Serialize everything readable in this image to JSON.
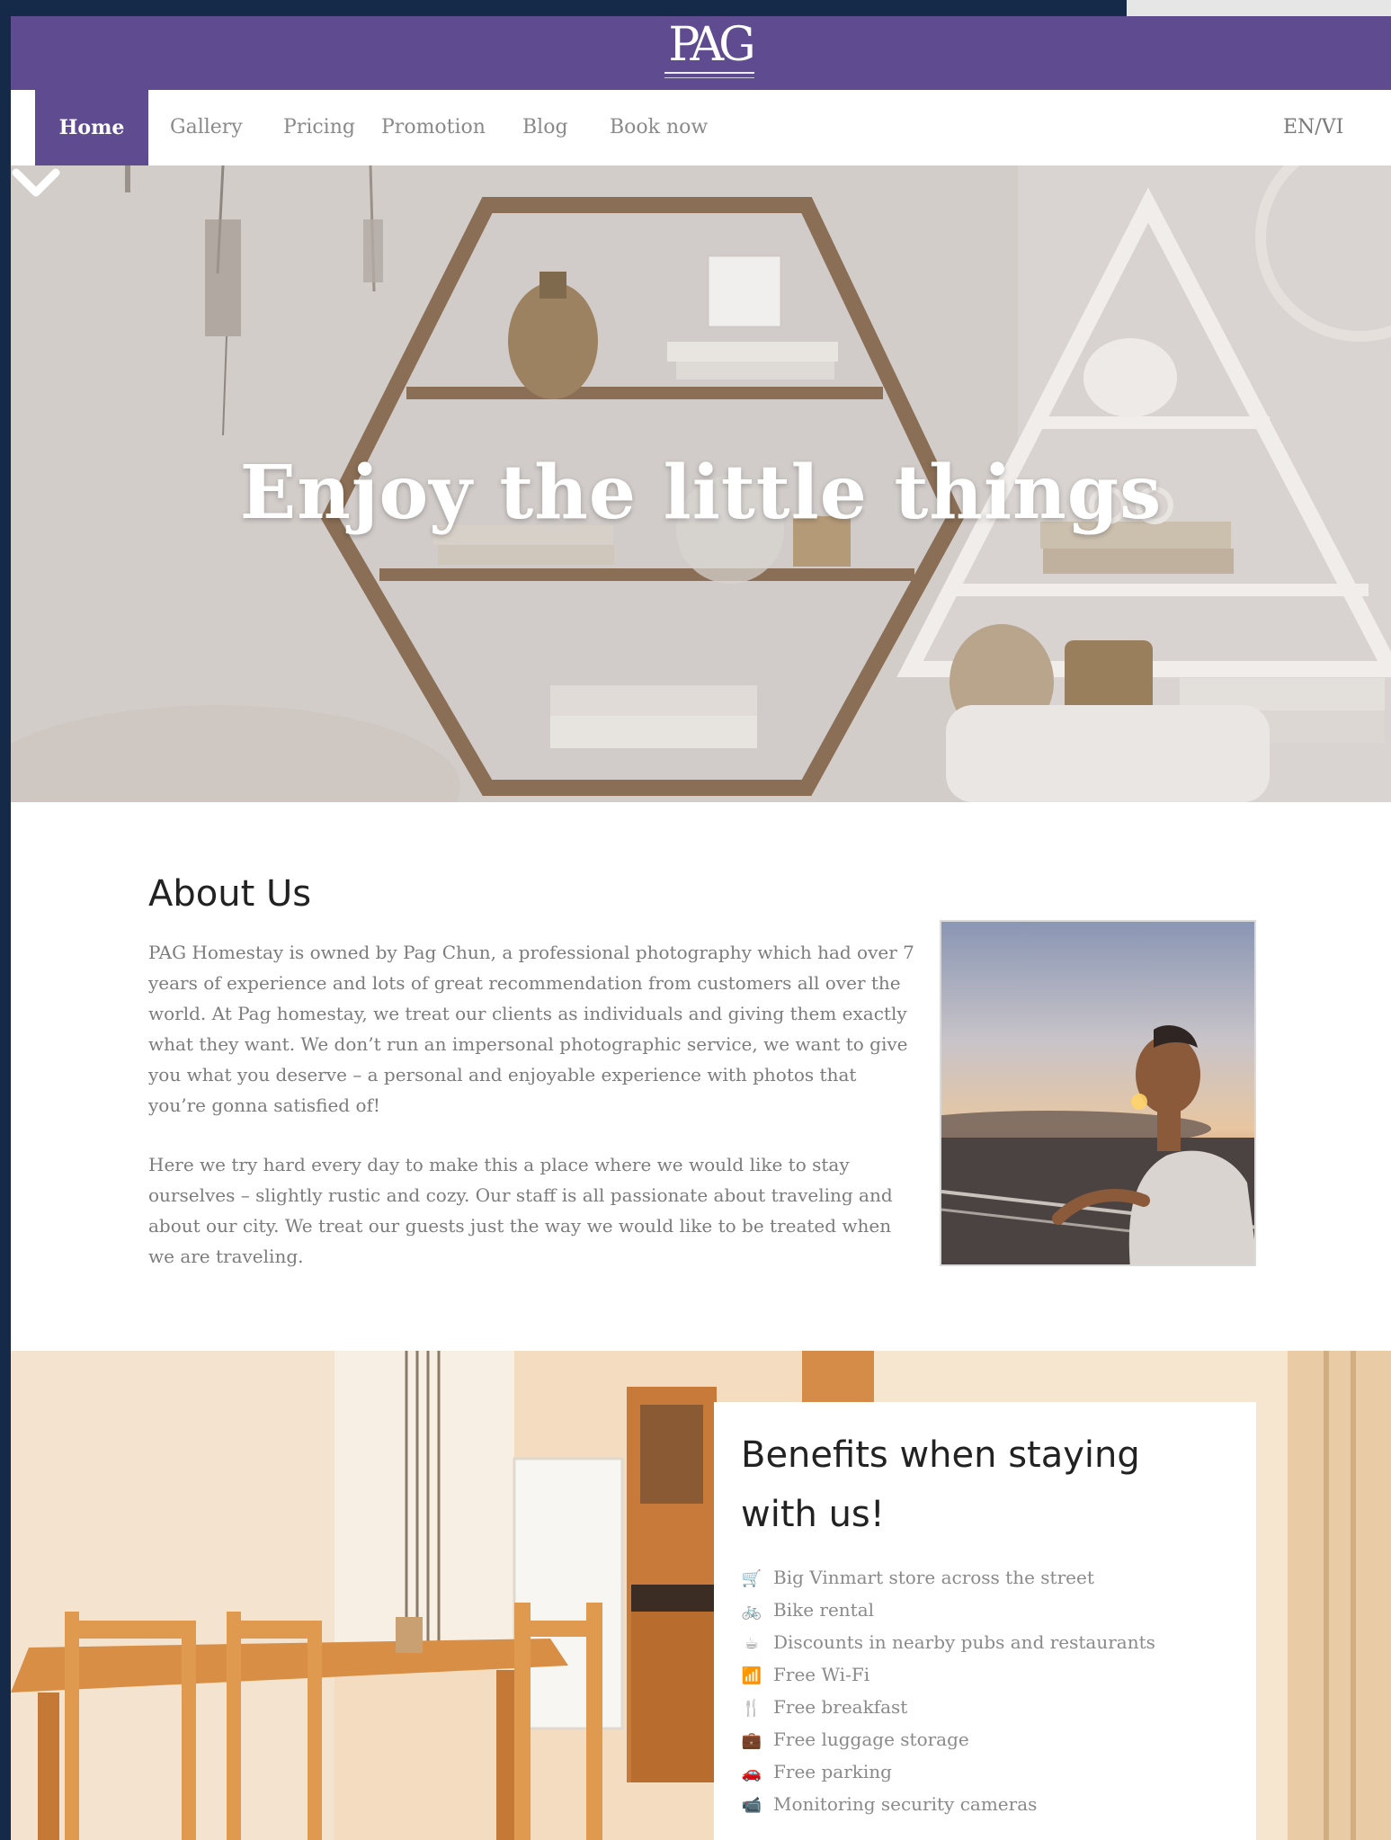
{
  "brand": {
    "logo_text": "PAG",
    "accent_color": "#5f4b8f"
  },
  "nav": {
    "items": [
      {
        "label": "Home",
        "active": true
      },
      {
        "label": "Gallery",
        "active": false
      },
      {
        "label": "Pricing",
        "active": false
      },
      {
        "label": "Promotion",
        "active": false
      },
      {
        "label": "Blog",
        "active": false
      },
      {
        "label": "Book now",
        "active": false
      }
    ],
    "language": "EN/VI"
  },
  "hero": {
    "title": "Enjoy the little things",
    "scroll_icon": "chevron-down-icon"
  },
  "about": {
    "heading": "About Us",
    "paragraph_1": "PAG Homestay is owned by Pag Chun, a professional photography  which had over 7 years of experience and lots of great recommendation from customers all over the world. At Pag homestay, we treat our clients as individuals and giving them exactly what they want. We don’t run an impersonal photographic service, we want to give you what you deserve – a personal and enjoyable experience with photos that you’re gonna satisfied of!",
    "paragraph_2": "Here we try hard every day to make this  a place where we would like to stay ourselves – slightly rustic and cozy. Our staff is all passionate about traveling and about our city. We treat our guests just the way we would like to be treated when we are traveling."
  },
  "benefits": {
    "title": "Benefits when staying with us!",
    "items": [
      {
        "icon": "cart-icon",
        "label": "Big Vinmart store across the street"
      },
      {
        "icon": "bike-icon",
        "label": "Bike rental"
      },
      {
        "icon": "coffee-icon",
        "label": "Discounts in nearby pubs and restaurants"
      },
      {
        "icon": "wifi-icon",
        "label": "Free Wi-Fi"
      },
      {
        "icon": "cutlery-icon",
        "label": "Free breakfast"
      },
      {
        "icon": "briefcase-icon",
        "label": "Free luggage storage"
      },
      {
        "icon": "car-icon",
        "label": "Free parking"
      },
      {
        "icon": "video-camera-icon",
        "label": "Monitoring security cameras"
      }
    ]
  }
}
